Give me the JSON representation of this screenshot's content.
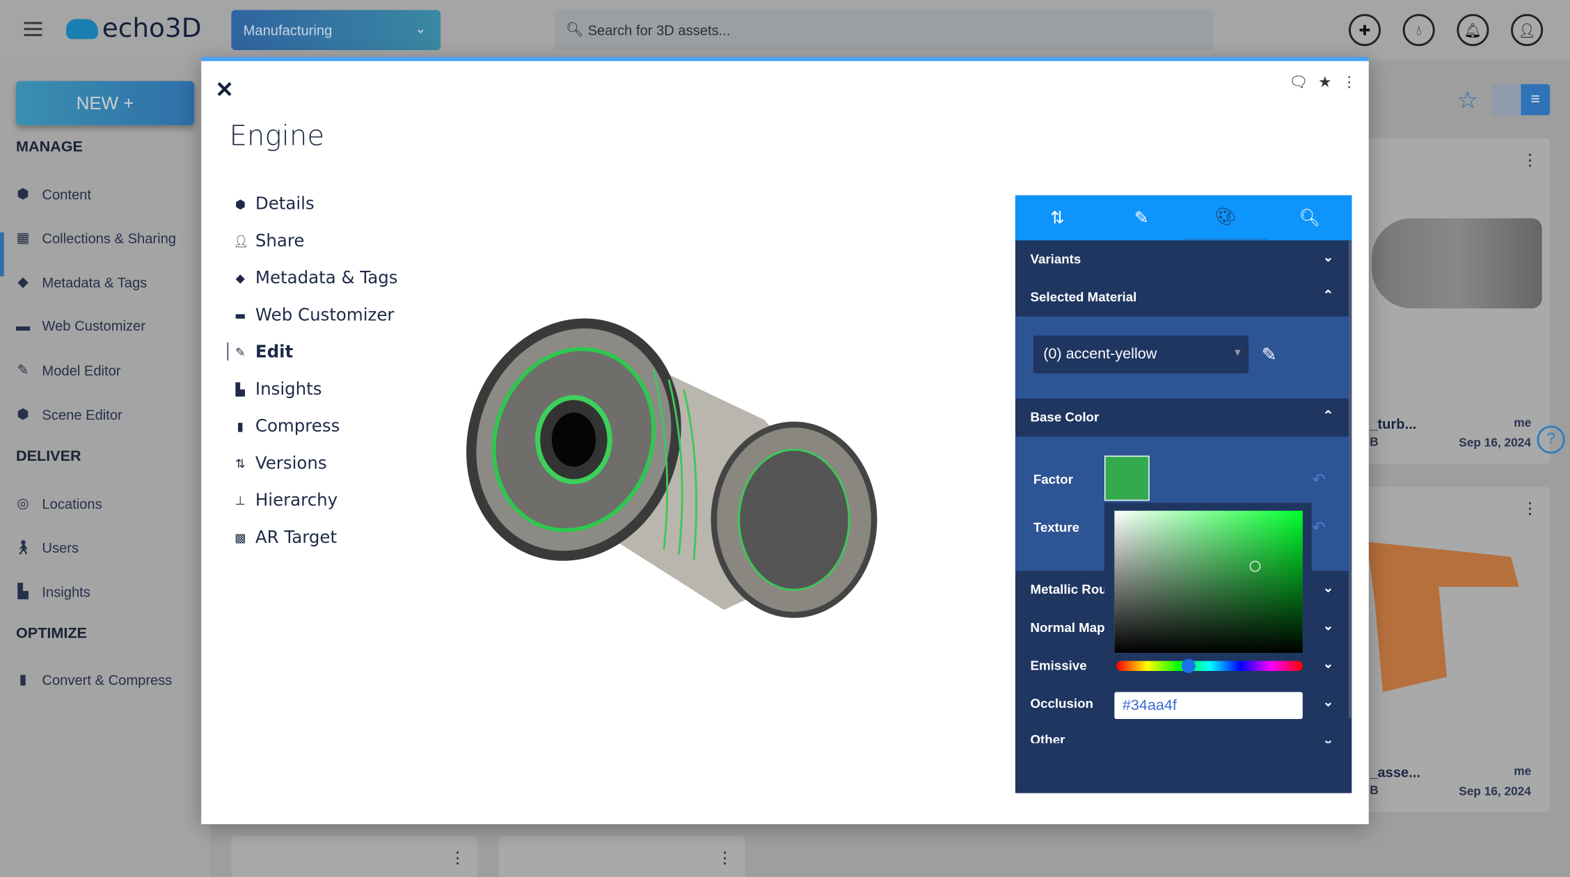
{
  "header": {
    "logo": "echo3D",
    "project": "Manufacturing",
    "search_placeholder": "Search for 3D assets...",
    "icons": [
      "puzzle-icon",
      "drop-icon",
      "bell-icon",
      "user-icon"
    ]
  },
  "sidebar": {
    "new_label": "NEW +",
    "sections": [
      {
        "title": "MANAGE",
        "items": [
          {
            "label": "Content",
            "icon": "cube-icon"
          },
          {
            "label": "Collections & Sharing",
            "icon": "grid-icon"
          },
          {
            "label": "Metadata & Tags",
            "icon": "tag-icon"
          },
          {
            "label": "Web Customizer",
            "icon": "vr-icon"
          },
          {
            "label": "Model Editor",
            "icon": "pencil-icon"
          },
          {
            "label": "Scene Editor",
            "icon": "cubes-icon"
          }
        ]
      },
      {
        "title": "DELIVER",
        "items": [
          {
            "label": "Locations",
            "icon": "location-icon"
          },
          {
            "label": "Users",
            "icon": "person-icon"
          },
          {
            "label": "Insights",
            "icon": "chart-icon"
          }
        ]
      },
      {
        "title": "OPTIMIZE",
        "items": [
          {
            "label": "Convert & Compress",
            "icon": "file-icon"
          }
        ]
      }
    ]
  },
  "cards": [
    {
      "name": "_turb...",
      "size": "B",
      "owner": "me",
      "date": "Sep 16, 2024"
    },
    {
      "name": "_asse...",
      "size": "B",
      "owner": "me",
      "date": "Sep 16, 2024"
    }
  ],
  "modal": {
    "title": "Engine",
    "nav": [
      {
        "label": "Details"
      },
      {
        "label": "Share"
      },
      {
        "label": "Metadata & Tags"
      },
      {
        "label": "Web Customizer"
      },
      {
        "label": "Edit"
      },
      {
        "label": "Insights"
      },
      {
        "label": "Compress"
      },
      {
        "label": "Versions"
      },
      {
        "label": "Hierarchy"
      },
      {
        "label": "AR Target"
      }
    ],
    "active_nav": "Edit"
  },
  "panel": {
    "tabs": [
      "transform-icon",
      "pencil-icon",
      "palette-icon",
      "search-icon"
    ],
    "active_tab": "palette-icon",
    "variants": "Variants",
    "selected_material": "Selected Material",
    "material_value": "(0) accent-yellow",
    "base_color": "Base Color",
    "factor": "Factor",
    "texture": "Texture",
    "factor_color": "#34aa4f",
    "metallic": "Metallic Rou",
    "normal_map": "Normal Map",
    "emissive": "Emissive",
    "occlusion": "Occlusion",
    "other": "Other",
    "hex_value": "#34aa4f"
  }
}
